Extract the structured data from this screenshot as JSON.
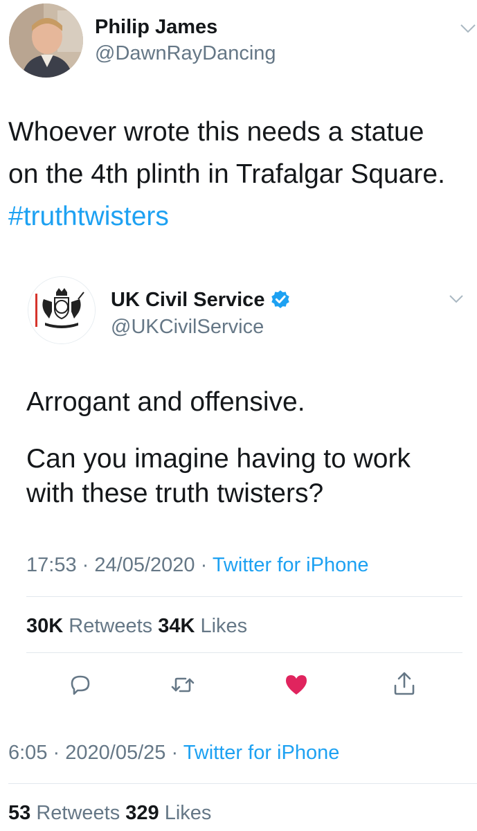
{
  "tweet": {
    "author": {
      "name": "Philip James",
      "handle": "@DawnRayDancing"
    },
    "text_lines": [
      "Whoever wrote this needs a statue",
      "on the 4th plinth in Trafalgar Square."
    ],
    "hashtag": "#truthtwisters",
    "time": "6:05",
    "date": "2020/05/25",
    "sep": "·",
    "source": "Twitter for iPhone",
    "retweets_count": "53",
    "retweets_label": "Retweets",
    "likes_count": "329",
    "likes_label": "Likes"
  },
  "quoted": {
    "author": {
      "name": "UK Civil Service",
      "handle": "@UKCivilService",
      "verified": true
    },
    "line1": "Arrogant and offensive.",
    "line2": [
      "Can you imagine having to work",
      "with these truth twisters?"
    ],
    "time": "17:53",
    "date": "24/05/2020",
    "sep": "·",
    "source": "Twitter for iPhone",
    "retweets_count": "30K",
    "retweets_label": "Retweets",
    "likes_count": "34K",
    "likes_label": "Likes",
    "actions": [
      {
        "icon": "reply-icon"
      },
      {
        "icon": "retweet-icon"
      },
      {
        "icon": "heart-icon",
        "active": true
      },
      {
        "icon": "share-icon"
      }
    ]
  },
  "colors": {
    "link": "#1da1f2",
    "muted": "#657786",
    "text": "#14171a",
    "like": "#e0245e",
    "icon": "#657786"
  }
}
